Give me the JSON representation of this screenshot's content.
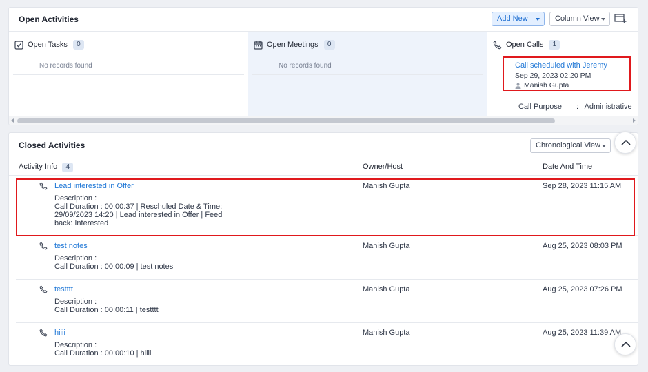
{
  "open_activities": {
    "title": "Open Activities",
    "add_new_label": "Add New",
    "column_view_label": "Column View",
    "columns": {
      "tasks": {
        "label": "Open Tasks",
        "count": "0",
        "empty_text": "No records found"
      },
      "meetings": {
        "label": "Open Meetings",
        "count": "0",
        "empty_text": "No records found"
      },
      "calls": {
        "label": "Open Calls",
        "count": "1",
        "item": {
          "title": "Call scheduled with Jeremy",
          "datetime": "Sep 29, 2023 02:20 PM",
          "owner": "Manish Gupta",
          "purpose_label": "Call Purpose",
          "purpose_sep": ":",
          "purpose_value": "Administrative"
        }
      }
    }
  },
  "closed_activities": {
    "title": "Closed Activities",
    "view_label": "Chronological View",
    "headers": {
      "activity_info": "Activity Info",
      "count": "4",
      "owner": "Owner/Host",
      "date": "Date And Time"
    },
    "rows": [
      {
        "title": "Lead interested in Offer",
        "desc_label": "Description :",
        "desc": "Call Duration : 00:00:37 | Reschuled Date & Time: 29/09/2023 14:20 | Lead interested in Offer | Feedback: Interested",
        "owner": "Manish Gupta",
        "date": "Sep 28, 2023 11:15 AM"
      },
      {
        "title": "test notes",
        "desc_label": "Description :",
        "desc": "Call Duration : 00:00:09 | test notes",
        "owner": "Manish Gupta",
        "date": "Aug 25, 2023 08:03 PM"
      },
      {
        "title": "testttt",
        "desc_label": "Description :",
        "desc": "Call Duration : 00:00:11 | testttt",
        "owner": "Manish Gupta",
        "date": "Aug 25, 2023 07:26 PM"
      },
      {
        "title": "hiiii",
        "desc_label": "Description :",
        "desc": "Call Duration : 00:00:10 | hiiii",
        "owner": "Manish Gupta",
        "date": "Aug 25, 2023 11:39 AM"
      }
    ]
  },
  "colors": {
    "link": "#1f77d6",
    "highlight": "#e0191d",
    "meetings_bg": "#eef3fb",
    "badge_bg": "#dde6f3"
  },
  "icons": {
    "tasks": "checkbox-icon",
    "meetings": "calendar-icon",
    "calls": "phone-icon",
    "owner": "person-icon",
    "widget": "add-widget-icon",
    "scroll": "chevron-up-icon"
  }
}
